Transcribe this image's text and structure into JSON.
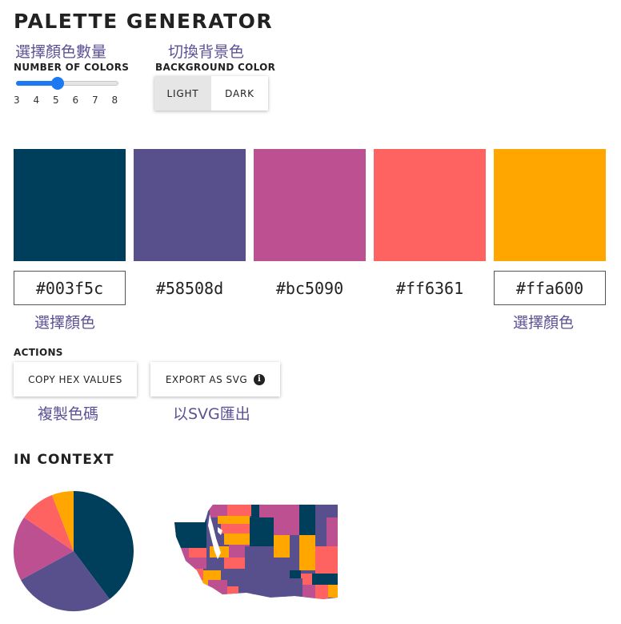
{
  "header": {
    "title": "PALETTE GENERATOR"
  },
  "controls": {
    "number_zh": "選擇顏色數量",
    "number_label": "NUMBER OF COLORS",
    "ticks": [
      "3",
      "4",
      "5",
      "6",
      "7",
      "8"
    ],
    "selected_count": 5,
    "bg_zh": "切換背景色",
    "bg_label": "BACKGROUND COLOR",
    "bg_options": [
      "LIGHT",
      "DARK"
    ],
    "bg_selected": "LIGHT"
  },
  "palette": {
    "colors": [
      {
        "hex": "#003f5c",
        "color": "#003f5c"
      },
      {
        "hex": "#58508d",
        "color": "#58508d"
      },
      {
        "hex": "#bc5090",
        "color": "#bc5090"
      },
      {
        "hex": "#ff6361",
        "color": "#ff6361"
      },
      {
        "hex": "#ffa600",
        "color": "#ffa600"
      }
    ],
    "pick_zh_left": "選擇顏色",
    "pick_zh_right": "選擇顏色"
  },
  "actions": {
    "label": "ACTIONS",
    "copy_label": "COPY HEX VALUES",
    "copy_zh": "複製色碼",
    "export_label": "EXPORT AS SVG",
    "export_zh": "以SVG匯出"
  },
  "context": {
    "label": "IN CONTEXT"
  }
}
